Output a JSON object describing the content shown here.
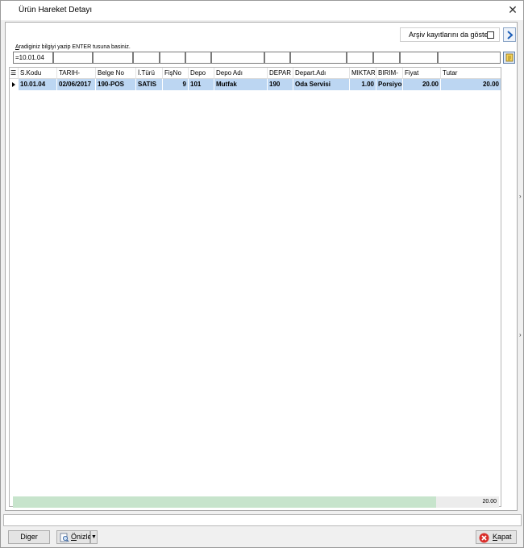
{
  "window": {
    "title": "Ürün Hareket Detayı"
  },
  "toolbar": {
    "archive_label": "Arşiv kayıtlarını da göster",
    "archive_checked": false
  },
  "search": {
    "hint": "Aradiginiz bilgiyi yazip ENTER tusuna basiniz.",
    "hint_first_letter": "A",
    "hint_rest": "radiginiz bilgiyi yazip ENTER tusuna basiniz.",
    "filter_value": "=10.01.04"
  },
  "grid": {
    "columns": [
      "S.Kodu",
      "TARIH-",
      "Belge No",
      "İ.Türü",
      "FişNo",
      "Depo",
      "Depo Adı",
      "DEPAR",
      "Depart.Adı",
      "MIKTAR",
      "BIRIM-",
      "Fiyat",
      "Tutar"
    ],
    "rows": [
      [
        "10.01.04",
        "02/06/2017",
        "190-POS",
        "SATIS",
        "9",
        "101",
        "Mutfak",
        "190",
        "Oda Servisi",
        "1.00",
        "Porsiyon",
        "20.00",
        "20.00"
      ]
    ],
    "footer_total": "20.00"
  },
  "buttons": {
    "other": "Diger",
    "preview": "Önizle",
    "preview_underline": "Ö",
    "preview_rest": "nizle",
    "close": "Kapat",
    "close_underline": "K",
    "close_rest": "apat"
  },
  "colors": {
    "selected_row": "#bcd6f2",
    "footer_bar": "#c7e4cc",
    "close_icon": "#d9302c"
  }
}
